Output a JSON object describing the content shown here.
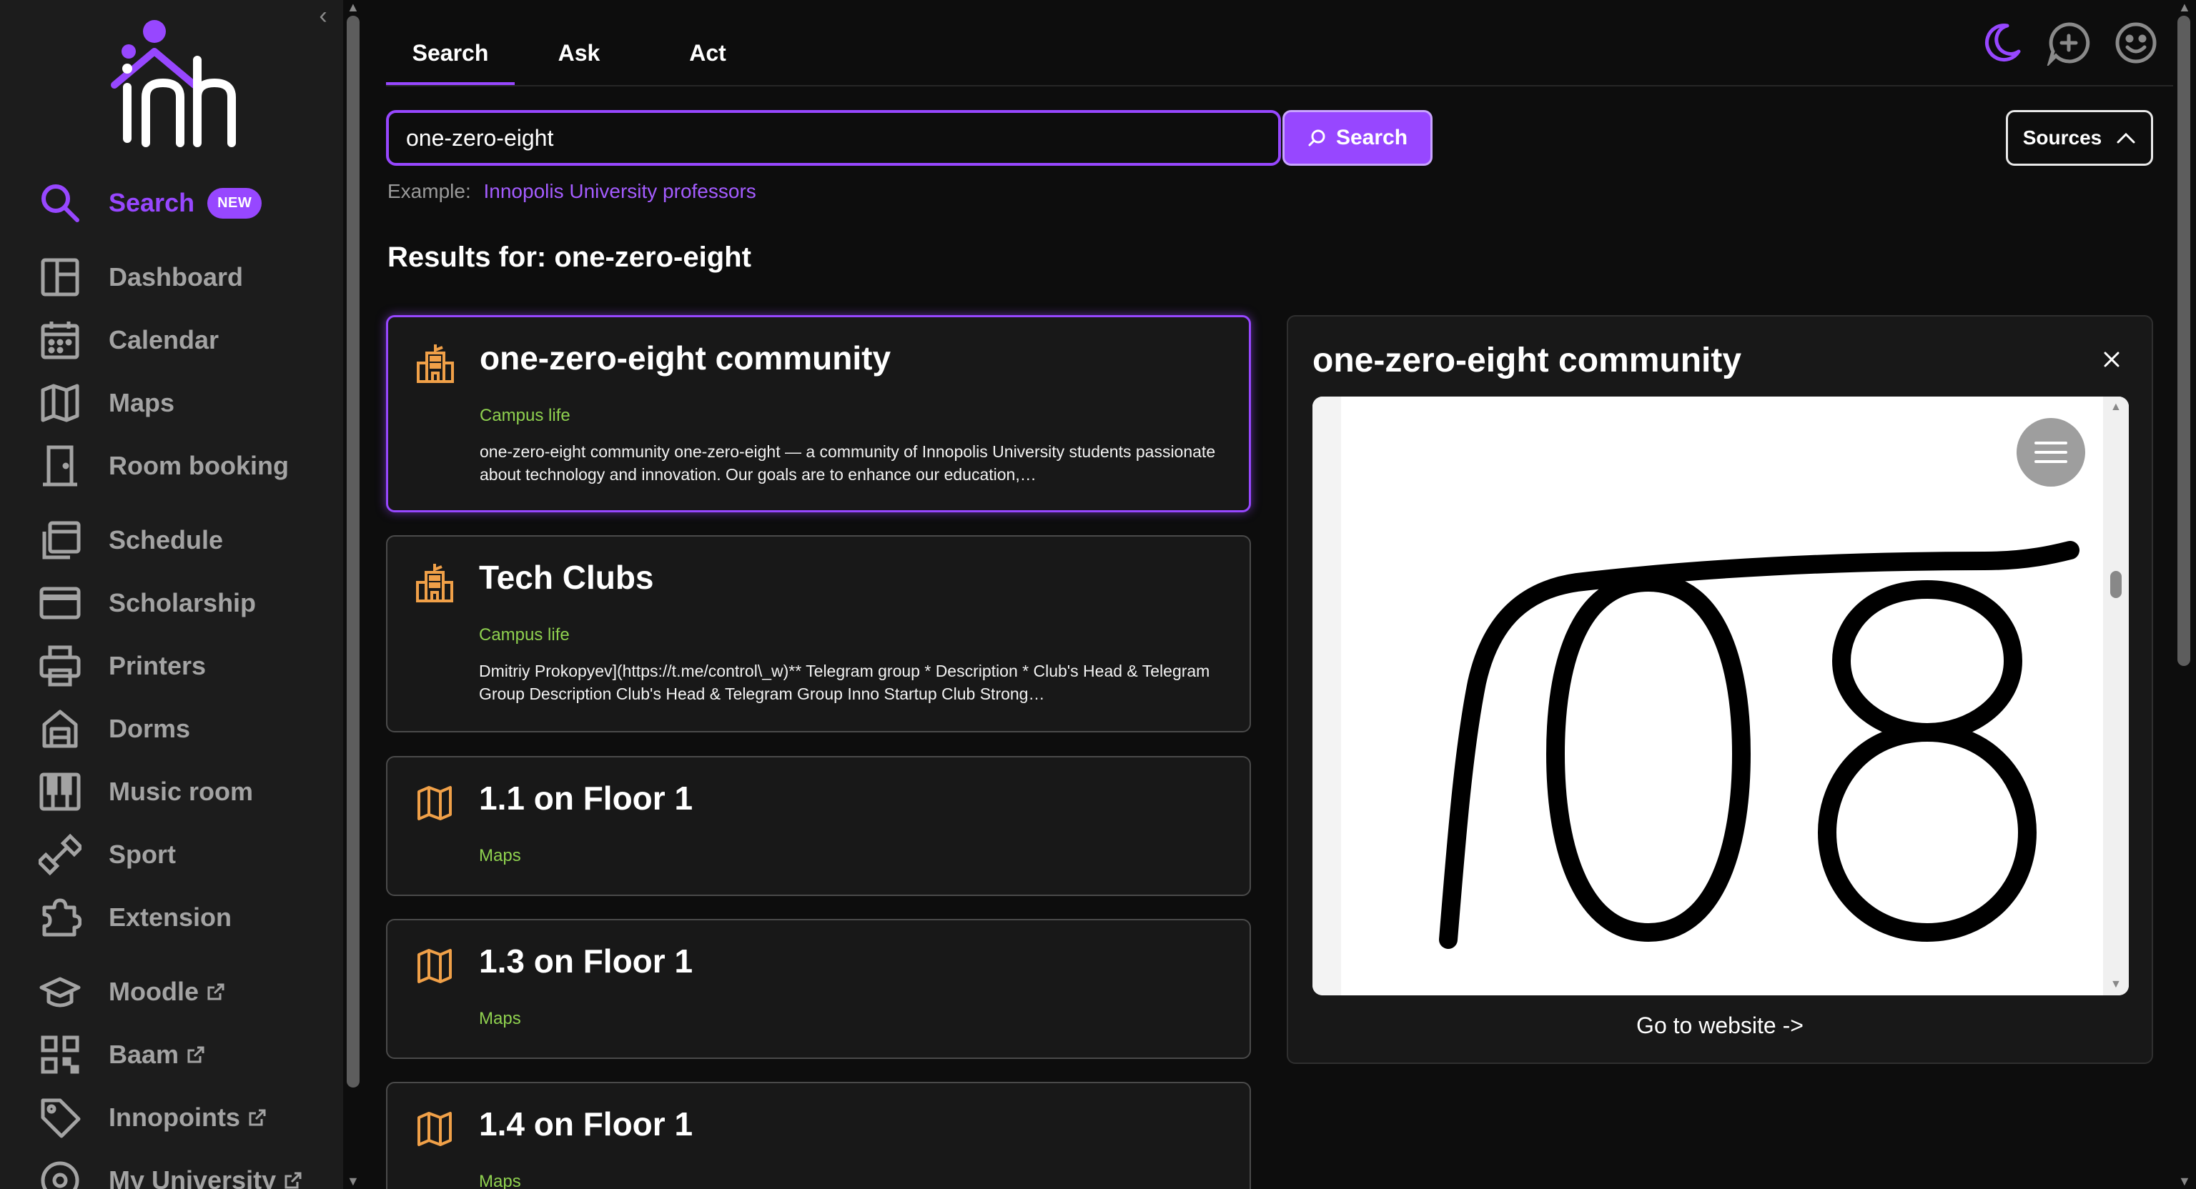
{
  "sidebar": {
    "logo_text": "inh",
    "items": [
      {
        "label": "Search",
        "badge": "NEW"
      },
      {
        "label": "Dashboard"
      },
      {
        "label": "Calendar"
      },
      {
        "label": "Maps"
      },
      {
        "label": "Room booking"
      },
      {
        "label": "Schedule"
      },
      {
        "label": "Scholarship"
      },
      {
        "label": "Printers"
      },
      {
        "label": "Dorms"
      },
      {
        "label": "Music room"
      },
      {
        "label": "Sport"
      },
      {
        "label": "Extension"
      },
      {
        "label": "Moodle"
      },
      {
        "label": "Baam"
      },
      {
        "label": "Innopoints"
      },
      {
        "label": "My University"
      }
    ]
  },
  "tabs": [
    {
      "label": "Search"
    },
    {
      "label": "Ask"
    },
    {
      "label": "Act"
    }
  ],
  "search": {
    "value": "one-zero-eight",
    "button_label": "Search",
    "sources_label": "Sources",
    "example_prefix": "Example:",
    "example_link": "Innopolis University professors"
  },
  "results": {
    "title": "Results for: one-zero-eight",
    "items": [
      {
        "title": "one-zero-eight community",
        "category": "Campus life",
        "description": "one-zero-eight community one-zero-eight — a community of Innopolis University students passionate about technology and innovation. Our goals are to enhance our education,…"
      },
      {
        "title": "Tech Clubs",
        "category": "Campus life",
        "description": "Dmitriy Prokopyev](https://t.me/control\\_w)** Telegram group * Description * Club's Head & Telegram Group Description Club's Head & Telegram Group Inno Startup Club Strong…"
      },
      {
        "title": "1.1 on Floor 1",
        "category": "Maps"
      },
      {
        "title": "1.3 on Floor 1",
        "category": "Maps"
      },
      {
        "title": "1.4 on Floor 1",
        "category": "Maps"
      }
    ]
  },
  "preview": {
    "title": "one-zero-eight community",
    "link_label": "Go to website ->"
  },
  "colors": {
    "accent": "#9747ff",
    "category": "#8fd14f",
    "icon_orange": "#f0a048"
  }
}
